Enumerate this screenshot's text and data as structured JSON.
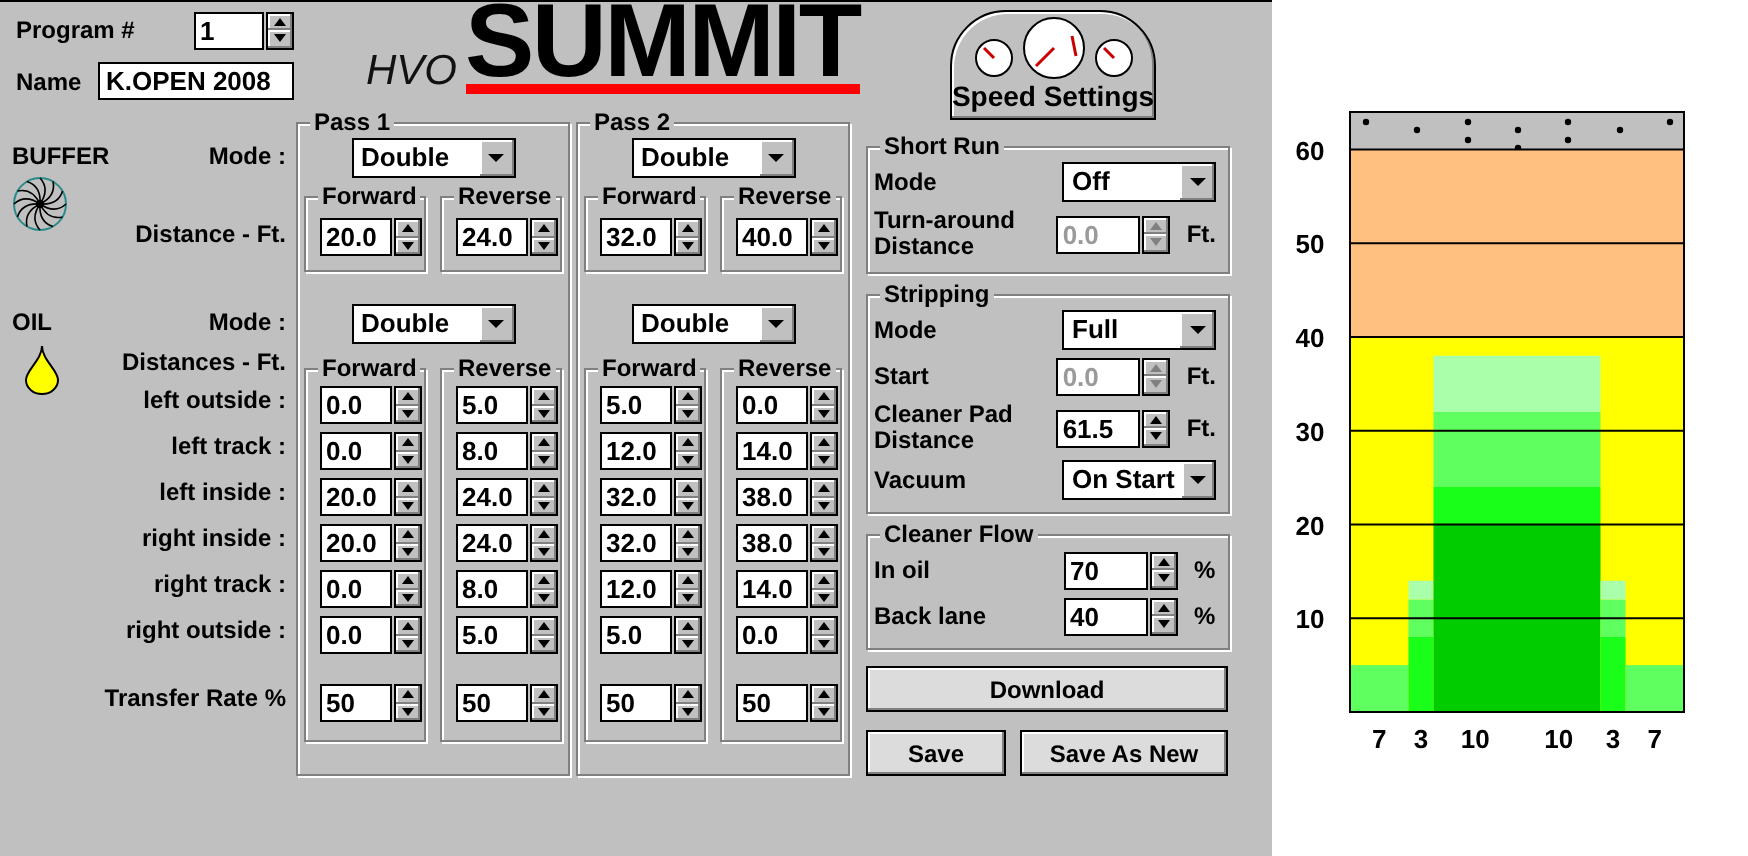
{
  "program": {
    "label": "Program #",
    "value": "1"
  },
  "name_field": {
    "label": "Name",
    "value": "K.OPEN 2008"
  },
  "logo": {
    "prefix": "HVO",
    "title": "SUMMIT"
  },
  "speed_settings": {
    "label": "Speed Settings"
  },
  "buffer": {
    "title": "BUFFER",
    "mode_label": "Mode :",
    "distance_label": "Distance - Ft."
  },
  "oil": {
    "title": "OIL",
    "mode_label": "Mode :",
    "distances_label": "Distances - Ft.",
    "row_labels": [
      "left outside :",
      "left track :",
      "left inside :",
      "right inside :",
      "right track :",
      "right outside :"
    ],
    "transfer_label": "Transfer Rate %"
  },
  "passes": [
    {
      "title": "Pass 1",
      "buffer_mode": "Double",
      "buffer": [
        {
          "label": "Forward",
          "value": "20.0"
        },
        {
          "label": "Reverse",
          "value": "24.0"
        }
      ],
      "oil_mode": "Double",
      "oil": [
        {
          "label": "Forward",
          "values": [
            "0.0",
            "0.0",
            "20.0",
            "20.0",
            "0.0",
            "0.0"
          ],
          "transfer": "50"
        },
        {
          "label": "Reverse",
          "values": [
            "5.0",
            "8.0",
            "24.0",
            "24.0",
            "8.0",
            "5.0"
          ],
          "transfer": "50"
        }
      ]
    },
    {
      "title": "Pass 2",
      "buffer_mode": "Double",
      "buffer": [
        {
          "label": "Forward",
          "value": "32.0"
        },
        {
          "label": "Reverse",
          "value": "40.0"
        }
      ],
      "oil_mode": "Double",
      "oil": [
        {
          "label": "Forward",
          "values": [
            "5.0",
            "12.0",
            "32.0",
            "32.0",
            "12.0",
            "5.0"
          ],
          "transfer": "50"
        },
        {
          "label": "Reverse",
          "values": [
            "0.0",
            "14.0",
            "38.0",
            "38.0",
            "14.0",
            "0.0"
          ],
          "transfer": "50"
        }
      ]
    }
  ],
  "groups": [
    {
      "title": "Short Run",
      "rows": [
        {
          "kind": "dropdown",
          "label": "Mode",
          "value": "Off",
          "disabled": false
        },
        {
          "kind": "spinner",
          "label": "Turn-around Distance",
          "value": "0.0",
          "unit": "Ft.",
          "disabled": true
        }
      ]
    },
    {
      "title": "Stripping",
      "rows": [
        {
          "kind": "dropdown",
          "label": "Mode",
          "value": "Full",
          "disabled": false
        },
        {
          "kind": "spinner",
          "label": "Start",
          "value": "0.0",
          "unit": "Ft.",
          "disabled": true
        },
        {
          "kind": "spinner",
          "label": "Cleaner Pad Distance",
          "value": "61.5",
          "unit": "Ft.",
          "disabled": false
        },
        {
          "kind": "dropdown",
          "label": "Vacuum",
          "value": "On Start",
          "disabled": false
        }
      ]
    },
    {
      "title": "Cleaner Flow",
      "rows": [
        {
          "kind": "spinner",
          "label": "In oil",
          "value": "70",
          "unit": "%",
          "disabled": false
        },
        {
          "kind": "spinner",
          "label": "Back lane",
          "value": "40",
          "unit": "%",
          "disabled": false
        }
      ]
    }
  ],
  "buttons": [
    {
      "label": "Download"
    },
    {
      "label": "Save"
    },
    {
      "label": "Save As New"
    }
  ],
  "lane_chart": {
    "chart_data": {
      "type": "bar",
      "stacked": true,
      "categories": [
        "7",
        "3",
        "10",
        "10",
        "3",
        "7"
      ],
      "series": [
        {
          "color": "#00cc00",
          "values": [
            0,
            0,
            20,
            20,
            0,
            0
          ]
        },
        {
          "color": "#19ff19",
          "values": [
            0,
            8,
            4,
            4,
            8,
            0
          ]
        },
        {
          "color": "#60ff60",
          "values": [
            5,
            4,
            8,
            8,
            4,
            5
          ]
        },
        {
          "color": "#aaffaa",
          "values": [
            0,
            2,
            6,
            6,
            2,
            0
          ]
        }
      ],
      "ylim": [
        0,
        64
      ],
      "yticks": [
        10,
        20,
        30,
        40,
        50,
        60
      ],
      "grid": true
    }
  }
}
